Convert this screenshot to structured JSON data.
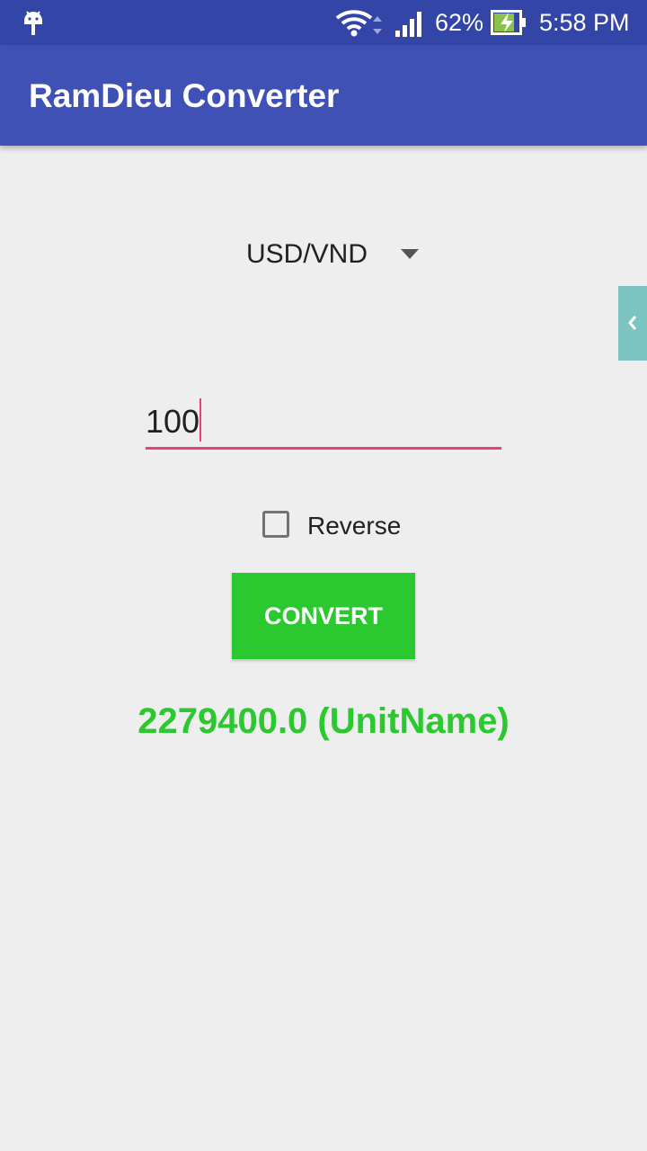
{
  "status_bar": {
    "battery_percent": "62%",
    "time": "5:58 PM",
    "icons": [
      "android-icon",
      "wifi-icon",
      "signal-icon",
      "battery-charging-icon"
    ]
  },
  "app_bar": {
    "title": "RamDieu Converter",
    "color": "#3f51b5"
  },
  "converter": {
    "currency_pair": "USD/VND",
    "amount": "100",
    "reverse_label": "Reverse",
    "reverse_checked": false,
    "convert_label": "CONVERT",
    "result": "2279400.0 (UnitName)"
  },
  "colors": {
    "accent": "#ec407a",
    "button": "#2bc82f",
    "result": "#2bc82f",
    "side_tab": "#7cc4c2"
  }
}
